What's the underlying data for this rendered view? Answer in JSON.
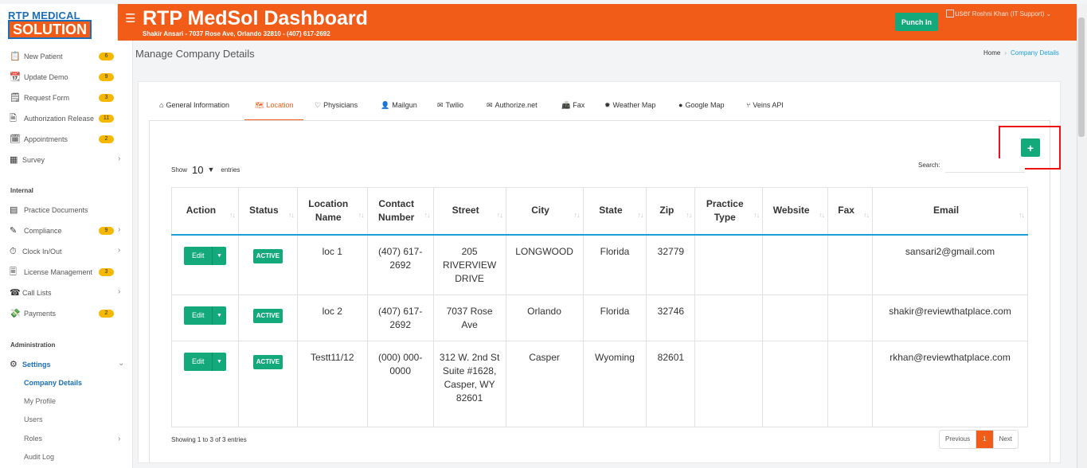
{
  "header": {
    "logo_line1": "RTP MEDICAL",
    "logo_line2": "SOLUTION",
    "menu_icon": "hamburger-icon",
    "title": "RTP MedSol Dashboard",
    "subtitle": "Shakir Ansari - 7037 Rose Ave, Orlando 32810 - (407) 617-2692",
    "punch_in": "Punch In",
    "user_alt": "user",
    "user_name": "Roshni Khan (IT Support)",
    "colors": {
      "brand": "#f25c19",
      "success": "#13a97a",
      "badge": "#f5b800",
      "link": "#1b9fd8"
    }
  },
  "sidebar": {
    "items": [
      {
        "label": "New Patient",
        "badge": "6",
        "icon": "clipboard-icon"
      },
      {
        "label": "Update Demo",
        "badge": "9",
        "icon": "calendar-icon"
      },
      {
        "label": "Request Form",
        "badge": "3",
        "icon": "form-icon"
      },
      {
        "label": "Authorization Release",
        "badge": "11",
        "icon": "authorization-icon"
      },
      {
        "label": "Appointments",
        "badge": "2",
        "icon": "appointment-icon"
      },
      {
        "label": "Survey",
        "icon": "survey-icon"
      }
    ],
    "section_internal": "Internal",
    "internal_items": [
      {
        "label": "Practice Documents",
        "icon": "documents-icon"
      },
      {
        "label": "Compliance",
        "badge": "9",
        "icon": "compliance-icon"
      },
      {
        "label": "Clock In/Out",
        "icon": "clock-icon"
      },
      {
        "label": "License Management",
        "badge": "3",
        "icon": "license-icon"
      },
      {
        "label": "Call Lists",
        "icon": "call-list-icon"
      },
      {
        "label": "Payments",
        "badge": "2",
        "icon": "payments-icon"
      }
    ],
    "section_admin": "Administration",
    "settings": {
      "label": "Settings",
      "icon": "gear-icon"
    },
    "sub_items": [
      "Company Details",
      "My Profile",
      "Users",
      "Roles",
      "Audit Log"
    ]
  },
  "page": {
    "title": "Manage Company Details",
    "breadcrumb": [
      "Home",
      "Company Details"
    ]
  },
  "tabs": [
    {
      "label": "General Information",
      "icon": "home-icon"
    },
    {
      "label": "Location",
      "icon": "map-icon",
      "active": true
    },
    {
      "label": "Physicians",
      "icon": "heart-icon"
    },
    {
      "label": "Mailgun",
      "icon": "user-icon"
    },
    {
      "label": "Twilio",
      "icon": "envelope-icon"
    },
    {
      "label": "Authorize.net",
      "icon": "envelope-icon"
    },
    {
      "label": "Fax",
      "icon": "fax-icon"
    },
    {
      "label": "Weather Map",
      "icon": "sun-icon"
    },
    {
      "label": "Google Map",
      "icon": "map-pin-icon"
    },
    {
      "label": "Veins API",
      "icon": "branch-icon"
    }
  ],
  "table_controls": {
    "show": "Show",
    "page_size": "10",
    "entries": "entries",
    "search_label": "Search:",
    "search_value": "",
    "add_label": "+"
  },
  "table": {
    "columns": [
      "Action",
      "Status",
      "Location Name",
      "Contact Number",
      "Street",
      "City",
      "State",
      "Zip",
      "Practice Type",
      "Website",
      "Fax",
      "Email"
    ],
    "rows": [
      {
        "edit": "Edit",
        "status": "ACTIVE",
        "name": "loc 1",
        "contact": "(407) 617-2692",
        "street": "205 RIVERVIEW DRIVE",
        "city": "LONGWOOD",
        "state": "Florida",
        "zip": "32779",
        "type": "",
        "website": "",
        "fax": "",
        "email": "sansari2@gmail.com"
      },
      {
        "edit": "Edit",
        "status": "ACTIVE",
        "name": "loc 2",
        "contact": "(407) 617-2692",
        "street": "7037 Rose Ave",
        "city": "Orlando",
        "state": "Florida",
        "zip": "32746",
        "type": "",
        "website": "",
        "fax": "",
        "email": "shakir@reviewthatplace.com"
      },
      {
        "edit": "Edit",
        "status": "ACTIVE",
        "name": "Testt11/12",
        "contact": "(000) 000-0000",
        "street": "312 W. 2nd St Suite #1628, Casper, WY 82601",
        "city": "Casper",
        "state": "Wyoming",
        "zip": "82601",
        "type": "",
        "website": "",
        "fax": "",
        "email": "rkhan@reviewthatplace.com"
      }
    ]
  },
  "footer": {
    "info": "Showing 1 to 3 of 3 entries",
    "previous": "Previous",
    "page": "1",
    "next": "Next"
  }
}
